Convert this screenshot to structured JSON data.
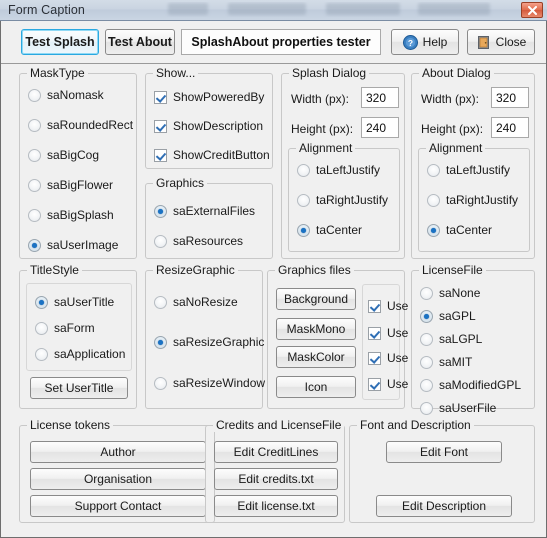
{
  "window": {
    "title": "Form Caption",
    "close_icon": "window-close-icon"
  },
  "toolbar": {
    "test_splash": "Test Splash",
    "test_about": "Test About",
    "title_field_value": "SplashAbout properties tester",
    "help": "Help",
    "help_icon": "help-circle-icon",
    "close": "Close",
    "close_icon": "door-exit-icon"
  },
  "mask_type": {
    "legend": "MaskType",
    "options": [
      {
        "label": "saNomask",
        "selected": false
      },
      {
        "label": "saRoundedRect",
        "selected": false
      },
      {
        "label": "saBigCog",
        "selected": false
      },
      {
        "label": "saBigFlower",
        "selected": false
      },
      {
        "label": "saBigSplash",
        "selected": false
      },
      {
        "label": "saUserImage",
        "selected": true
      }
    ]
  },
  "show": {
    "legend": "Show...",
    "options": [
      {
        "label": "ShowPoweredBy",
        "checked": true
      },
      {
        "label": "ShowDescription",
        "checked": true
      },
      {
        "label": "ShowCreditButton",
        "checked": true
      }
    ]
  },
  "graphics": {
    "legend": "Graphics",
    "options": [
      {
        "label": "saExternalFiles",
        "selected": true
      },
      {
        "label": "saResources",
        "selected": false
      }
    ]
  },
  "splash_dialog": {
    "legend": "Splash Dialog",
    "width_label": "Width (px):",
    "width_value": "320",
    "height_label": "Height (px):",
    "height_value": "240",
    "alignment_legend": "Alignment",
    "alignment_options": [
      {
        "label": "taLeftJustify",
        "selected": false
      },
      {
        "label": "taRightJustify",
        "selected": false
      },
      {
        "label": "taCenter",
        "selected": true
      }
    ]
  },
  "about_dialog": {
    "legend": "About Dialog",
    "width_label": "Width (px):",
    "width_value": "320",
    "height_label": "Height (px):",
    "height_value": "240",
    "alignment_legend": "Alignment",
    "alignment_options": [
      {
        "label": "taLeftJustify",
        "selected": false
      },
      {
        "label": "taRightJustify",
        "selected": false
      },
      {
        "label": "taCenter",
        "selected": true
      }
    ]
  },
  "title_style": {
    "legend": "TitleStyle",
    "options": [
      {
        "label": "saUserTitle",
        "selected": true
      },
      {
        "label": "saForm",
        "selected": false
      },
      {
        "label": "saApplication",
        "selected": false
      }
    ],
    "set_user_title": "Set UserTitle"
  },
  "resize_graphic": {
    "legend": "ResizeGraphic",
    "options": [
      {
        "label": "saNoResize",
        "selected": false
      },
      {
        "label": "saResizeGraphic",
        "selected": true
      },
      {
        "label": "saResizeWindow",
        "selected": false
      }
    ]
  },
  "graphics_files": {
    "legend": "Graphics files",
    "use_label": "Use",
    "rows": [
      {
        "button": "Background",
        "use_checked": true
      },
      {
        "button": "MaskMono",
        "use_checked": true
      },
      {
        "button": "MaskColor",
        "use_checked": true
      },
      {
        "button": "Icon",
        "use_checked": true
      }
    ]
  },
  "license_file": {
    "legend": "LicenseFile",
    "options": [
      {
        "label": "saNone",
        "selected": false
      },
      {
        "label": "saGPL",
        "selected": true
      },
      {
        "label": "saLGPL",
        "selected": false
      },
      {
        "label": "saMIT",
        "selected": false
      },
      {
        "label": "saModifiedGPL",
        "selected": false
      },
      {
        "label": "saUserFile",
        "selected": false
      }
    ]
  },
  "license_tokens": {
    "legend": "License tokens",
    "buttons": [
      "Author",
      "Organisation",
      "Support Contact"
    ]
  },
  "credits": {
    "legend": "Credits and LicenseFile",
    "buttons": [
      "Edit CreditLines",
      "Edit credits.txt",
      "Edit license.txt"
    ]
  },
  "font_description": {
    "legend": "Font and Description",
    "buttons": [
      "Edit Font",
      "Edit Description"
    ]
  },
  "colors": {
    "form_background": "#f0f0f0",
    "accent_focus": "#2aa8e0",
    "radio_dot": "#1a72c4",
    "check_mark": "#2f6fb5",
    "close_button": "#e06a4a"
  }
}
